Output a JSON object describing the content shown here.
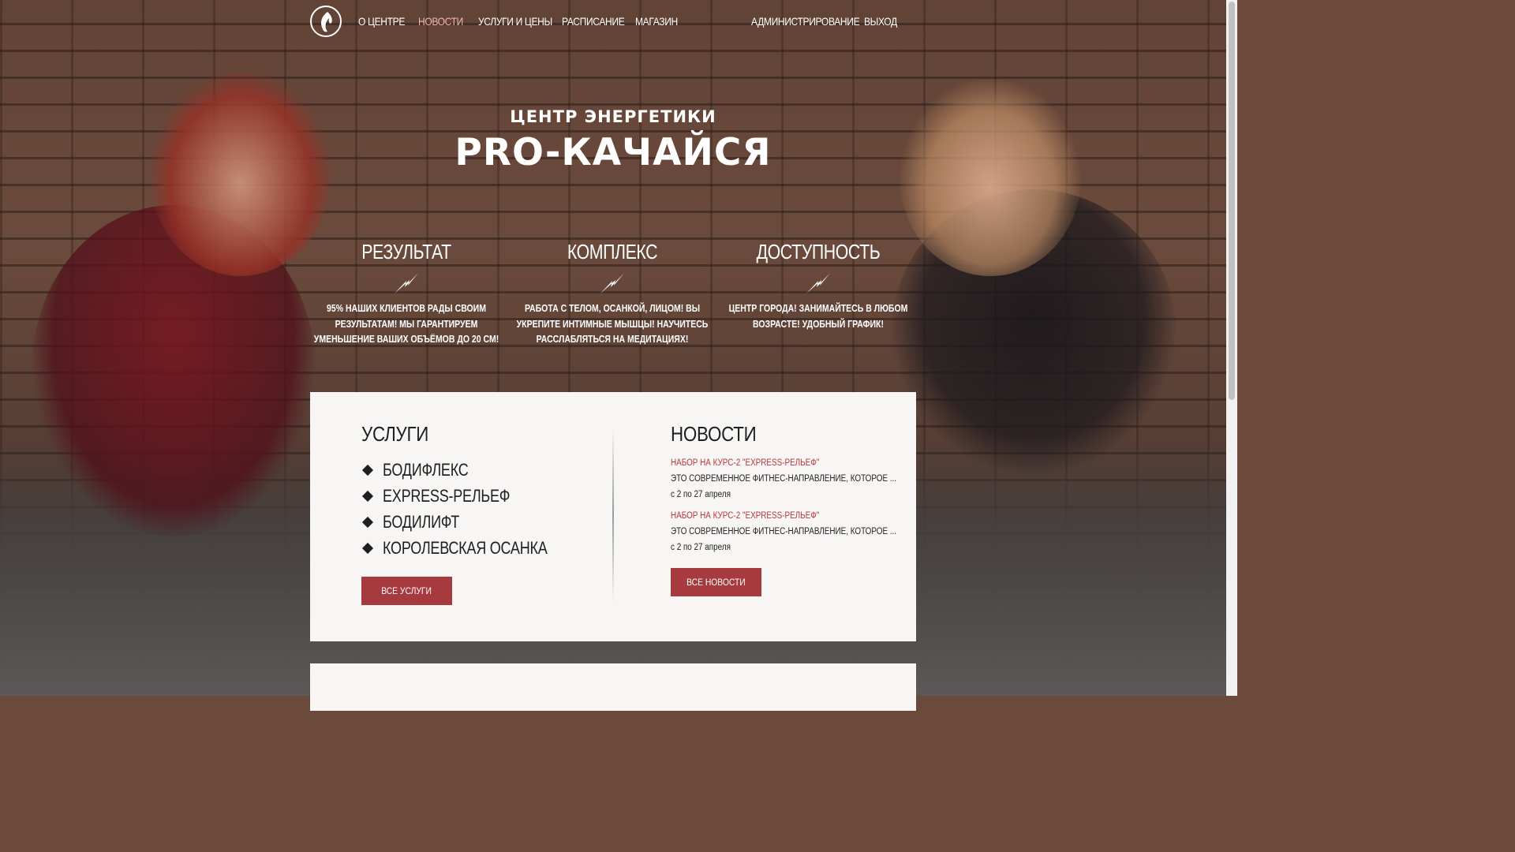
{
  "nav": {
    "items": [
      {
        "label": "О ЦЕНТРЕ"
      },
      {
        "label": "НОВОСТИ"
      },
      {
        "label": "УСЛУГИ И ЦЕНЫ"
      },
      {
        "label": "РАСПИСАНИЕ"
      },
      {
        "label": "МАГАЗИН"
      },
      {
        "label": "АДМИНИСТРИРОВАНИЕ"
      },
      {
        "label": "ВЫХОД"
      }
    ],
    "active_index": 1,
    "logo_icon": "flame-logo-icon"
  },
  "hero": {
    "subtitle": "ЦЕНТР ЭНЕРГЕТИКИ",
    "title": "PRO-КАЧАЙСЯ"
  },
  "features": [
    {
      "title": "РЕЗУЛЬТАТ",
      "icon": "lightning-icon",
      "text": "95% НАШИХ КЛИЕНТОВ РАДЫ СВОИМ РЕЗУЛЬТАТАМ! МЫ ГАРАНТИРУЕМ УМЕНЬШЕНИЕ ВАШИХ ОБЪЁМОВ ДО 20 СМ!"
    },
    {
      "title": "КОМПЛЕКС",
      "icon": "lightning-icon",
      "text": "РАБОТА С ТЕЛОМ, ОСАНКОЙ, ЛИЦОМ! ВЫ УКРЕПИТЕ ИНТИМНЫЕ МЫШЦЫ! НАУЧИТЕСЬ РАССЛАБЛЯТЬСЯ НА МЕДИТАЦИЯХ!"
    },
    {
      "title": "ДОСТУПНОСТЬ",
      "icon": "lightning-icon",
      "text": "ЦЕНТР ГОРОДА! ЗАНИМАЙТЕСЬ В ЛЮБОМ ВОЗРАСТЕ! УДОБНЫЙ ГРАФИК!"
    }
  ],
  "services": {
    "title": "УСЛУГИ",
    "items": [
      "БОДИФЛЕКС",
      "EXPRESS-РЕЛЬЕФ",
      "БОДИЛИФТ",
      "КОРОЛЕВСКАЯ ОСАНКА"
    ],
    "button_label": "ВСЕ УСЛУГИ"
  },
  "news": {
    "title": "НОВОСТИ",
    "items": [
      {
        "title": "НАБОР НА КУРС-2 \"EXPRESS-РЕЛЬЕФ\"",
        "desc": "ЭТО СОВРЕМЕННОЕ ФИТНЕС-НАПРАВЛЕНИЕ, КОТОРОЕ ...",
        "date": "с 2 по 27 апреля"
      },
      {
        "title": "НАБОР НА КУРС-2 \"EXPRESS-РЕЛЬЕФ\"",
        "desc": "ЭТО СОВРЕМЕННОЕ ФИТНЕС-НАПРАВЛЕНИЕ, КОТОРОЕ ...",
        "date": "с 2 по 27 апреля"
      }
    ],
    "button_label": "ВСЕ НОВОСТИ"
  },
  "colors": {
    "accent": "#a63a3e",
    "news_title": "#b5363c",
    "card_bg": "#f8f6f4"
  }
}
